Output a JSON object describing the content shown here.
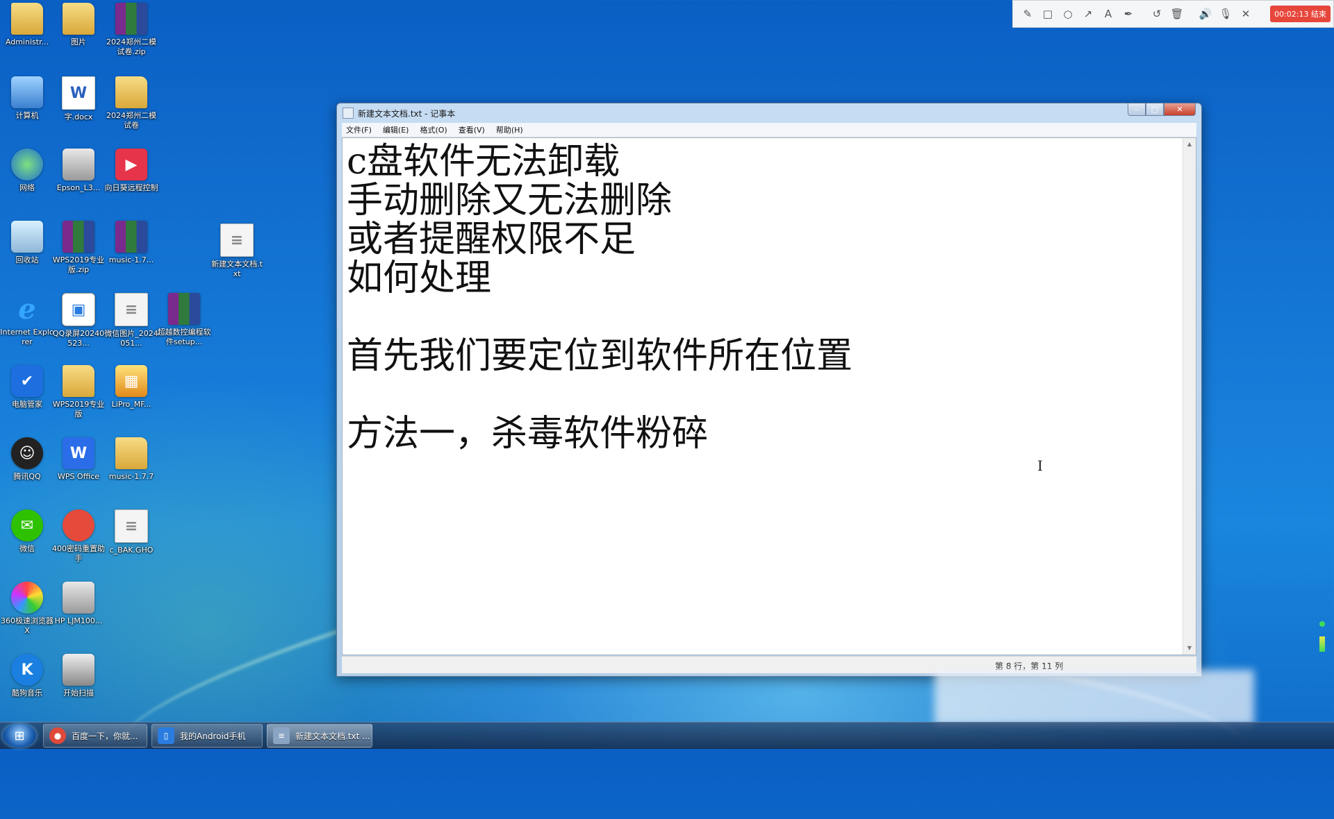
{
  "desktop": {
    "icons": [
      {
        "label": "Administr...",
        "glyph": "📁"
      },
      {
        "label": "图片",
        "glyph": "🖼"
      },
      {
        "label": "2024郑州二模试卷.zip",
        "glyph": "▤"
      },
      {
        "label": "计算机",
        "glyph": "🖥"
      },
      {
        "label": "字.docx",
        "glyph": "W"
      },
      {
        "label": "2024郑州二模试卷",
        "glyph": "📁"
      },
      {
        "label": "网络",
        "glyph": "●"
      },
      {
        "label": "Epson_L3...",
        "glyph": "🖨"
      },
      {
        "label": "向日葵远程控制",
        "glyph": "▶"
      },
      {
        "label": "回收站",
        "glyph": "🗑"
      },
      {
        "label": "WPS2019专业版.zip",
        "glyph": "▤"
      },
      {
        "label": "music-1.7...",
        "glyph": "▤"
      },
      {
        "label": "新建文本文档.txt",
        "glyph": "≡"
      },
      {
        "label": "Internet Explorer",
        "glyph": "e"
      },
      {
        "label": "QQ录屏20240523...",
        "glyph": "▣"
      },
      {
        "label": "微信图片_2024051...",
        "glyph": "≡"
      },
      {
        "label": "超越数控编程软件setup...",
        "glyph": "▤"
      },
      {
        "label": "电脑管家",
        "glyph": "✔"
      },
      {
        "label": "WPS2019专业版",
        "glyph": "📁"
      },
      {
        "label": "LiPro_MF...",
        "glyph": "▦"
      },
      {
        "label": "腾讯QQ",
        "glyph": "☺"
      },
      {
        "label": "WPS Office",
        "glyph": "W"
      },
      {
        "label": "music-1.7.7",
        "glyph": "📁"
      },
      {
        "label": "微信",
        "glyph": "✉"
      },
      {
        "label": "400密码重置助手",
        "glyph": "●"
      },
      {
        "label": "c_BAK.GHO",
        "glyph": "≡"
      },
      {
        "label": "360极速浏览器X",
        "glyph": "●"
      },
      {
        "label": "HP LJM100...",
        "glyph": "🖨"
      },
      {
        "label": "酷狗音乐",
        "glyph": "K"
      },
      {
        "label": "开始扫描",
        "glyph": "▣"
      }
    ]
  },
  "recorder": {
    "tools": [
      "✎",
      "□",
      "○",
      "↗",
      "A",
      "✒",
      "↺",
      "🗑",
      "🔊",
      "🎙",
      "✕"
    ],
    "time_label": "00:02:13 结束"
  },
  "notepad": {
    "title": "新建文本文档.txt - 记事本",
    "controls": {
      "minimize": "–",
      "maximize": "□",
      "close": "✕"
    },
    "menus": [
      "文件(F)",
      "编辑(E)",
      "格式(O)",
      "查看(V)",
      "帮助(H)"
    ],
    "content": "c盘软件无法卸载\n手动删除又无法删除\n或者提醒权限不足\n如何处理\n\n首先我们要定位到软件所在位置\n\n方法一，杀毒软件粉碎",
    "scroll_up": "▲",
    "scroll_down": "▼",
    "status_position": "第 8 行，第 11 列"
  },
  "taskbar": {
    "start_glyph": "⊞",
    "tasks": [
      {
        "label": "百度一下，你就...",
        "glyph": "●",
        "color": "#e0493a"
      },
      {
        "label": "我的Android手机",
        "glyph": "▯",
        "color": "#2a7ce0"
      },
      {
        "label": "新建文本文档.txt ...",
        "glyph": "≡",
        "color": "#8aa4c4"
      }
    ]
  }
}
